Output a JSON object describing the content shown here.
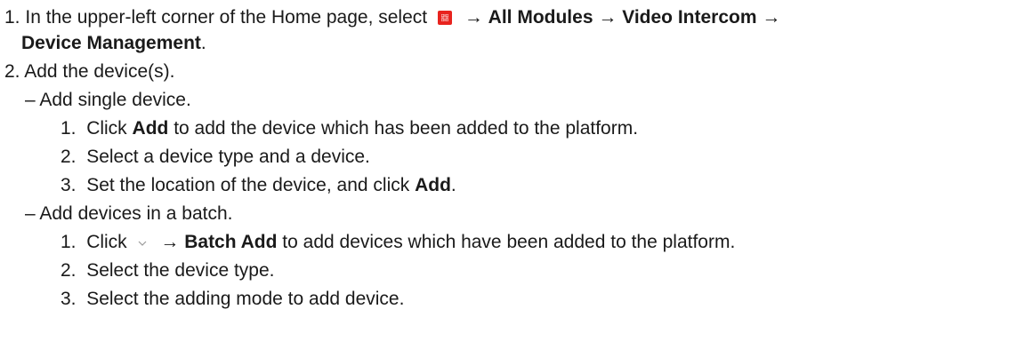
{
  "steps": [
    {
      "num": "1.",
      "pre": "In the upper-left corner of the Home page, select",
      "icon": "apps-grid-icon",
      "arrow": "→",
      "path1": "All Modules",
      "path2": "Video Intercom",
      "path3": "Device Management",
      "end": "."
    },
    {
      "num": "2.",
      "text": "Add the device(s)."
    }
  ],
  "single": {
    "dash": "–",
    "label": "Add single device.",
    "items": [
      {
        "num": "1.",
        "pre": "Click",
        "bold": "Add",
        "post": "to add the device which has been added to the platform."
      },
      {
        "num": "2.",
        "text": "Select a device type and a device."
      },
      {
        "num": "3.",
        "pre": "Set the location of the device, and click",
        "bold": "Add",
        "post": "."
      }
    ]
  },
  "batch": {
    "dash": "–",
    "label": "Add devices in a batch.",
    "items": [
      {
        "num": "1.",
        "pre": "Click",
        "icon": "chevron-down-icon",
        "arrow": "→",
        "bold": "Batch Add",
        "post": "to add devices which have been added to the platform."
      },
      {
        "num": "2.",
        "text": "Select the device type."
      },
      {
        "num": "3.",
        "text": "Select the adding mode to add device."
      }
    ]
  },
  "colors": {
    "accent": "#e8231e",
    "text": "#1a1a1a",
    "chevron": "#9a9a9a"
  }
}
